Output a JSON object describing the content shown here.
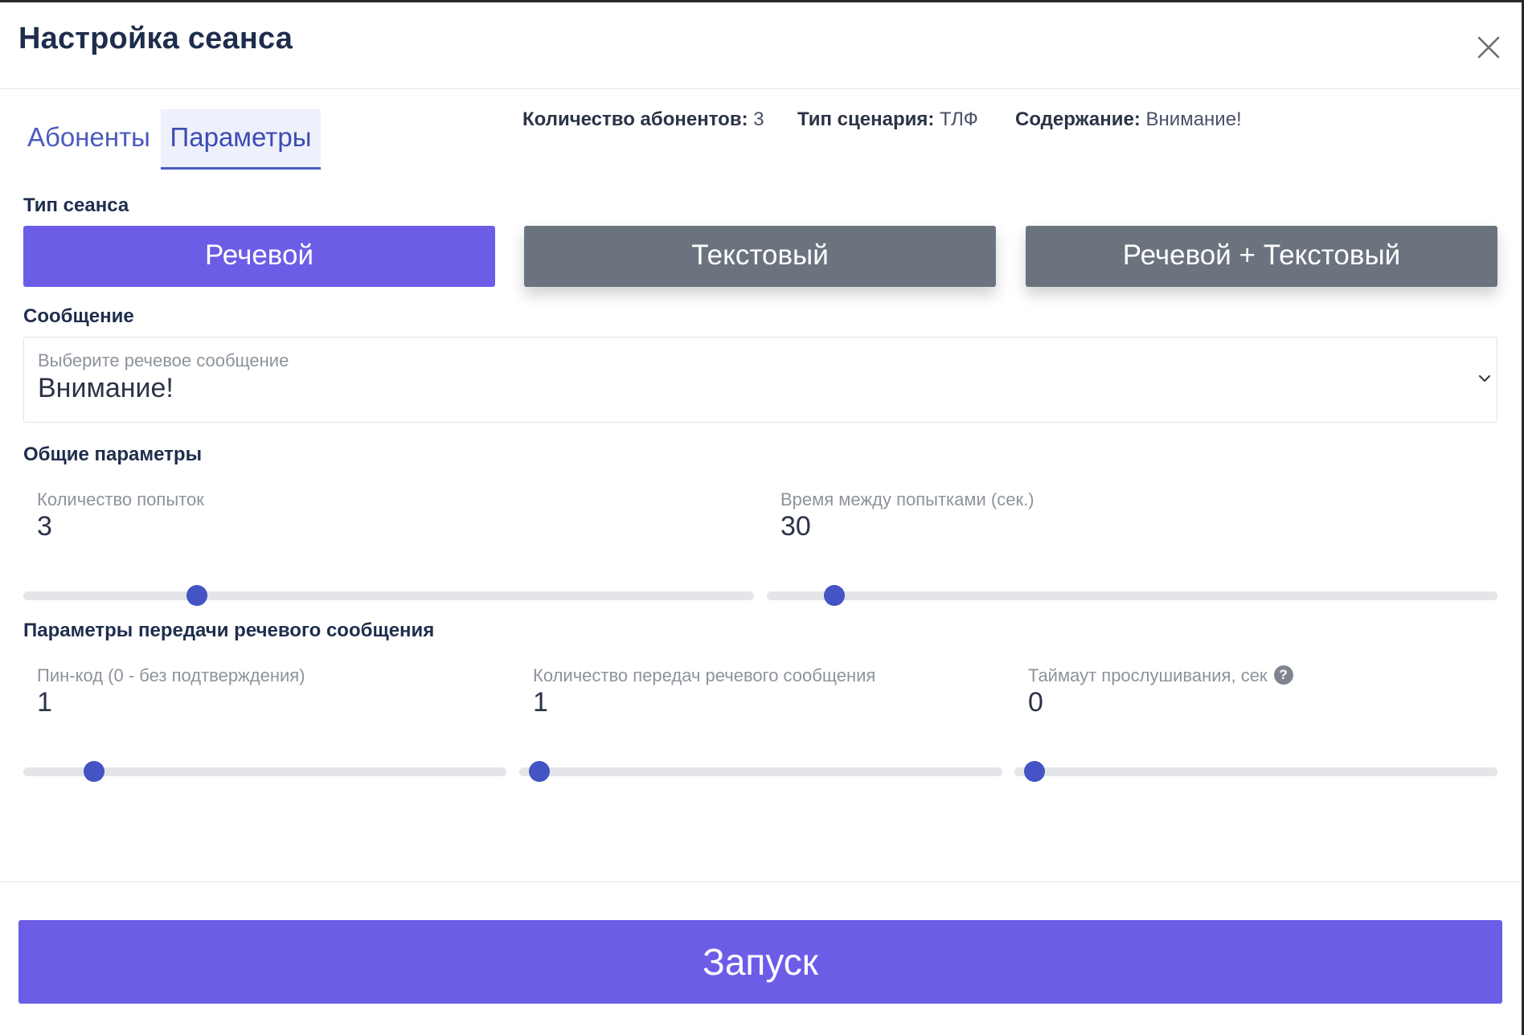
{
  "modal": {
    "title": "Настройка сеанса",
    "close_icon": "close-icon"
  },
  "tabs": [
    {
      "label": "Абоненты",
      "active": false
    },
    {
      "label": "Параметры",
      "active": true
    }
  ],
  "info": {
    "subscribers_label": "Количество абонентов:",
    "subscribers_value": "3",
    "scenario_label": "Тип сценария:",
    "scenario_value": "ТЛФ",
    "content_label": "Содержание:",
    "content_value": "Внимание!"
  },
  "session_type": {
    "label": "Тип сеанса",
    "options": [
      "Речевой",
      "Текстовый",
      "Речевой + Текстовый"
    ],
    "selected": "Речевой"
  },
  "message": {
    "label": "Сообщение",
    "placeholder": "Выберите речевое сообщение",
    "value": "Внимание!",
    "chevron_icon": "chevron-down-icon"
  },
  "general": {
    "label": "Общие параметры",
    "attempts": {
      "label": "Количество попыток",
      "value": "3",
      "slider_fraction": 0.23
    },
    "interval": {
      "label": "Время между попытками (сек.)",
      "value": "30",
      "slider_fraction": 0.08
    }
  },
  "voice_params": {
    "label": "Параметры передачи речевого сообщения",
    "pin": {
      "label": "Пин-код (0 - без подтверждения)",
      "value": "1",
      "slider_fraction": 0.13
    },
    "repeats": {
      "label": "Количество передач речевого сообщения",
      "value": "1",
      "slider_fraction": 0.02
    },
    "timeout": {
      "label": "Таймаут прослушивания, сек",
      "value": "0",
      "slider_fraction": 0.02,
      "help_icon": "help-circle-icon",
      "help_glyph": "?"
    }
  },
  "colors": {
    "accent": "#6c5de7",
    "inactive_button": "#6b747e",
    "slider_thumb": "#4454c4",
    "tab_text": "#4a5bbf"
  },
  "footer": {
    "launch_label": "Запуск"
  }
}
